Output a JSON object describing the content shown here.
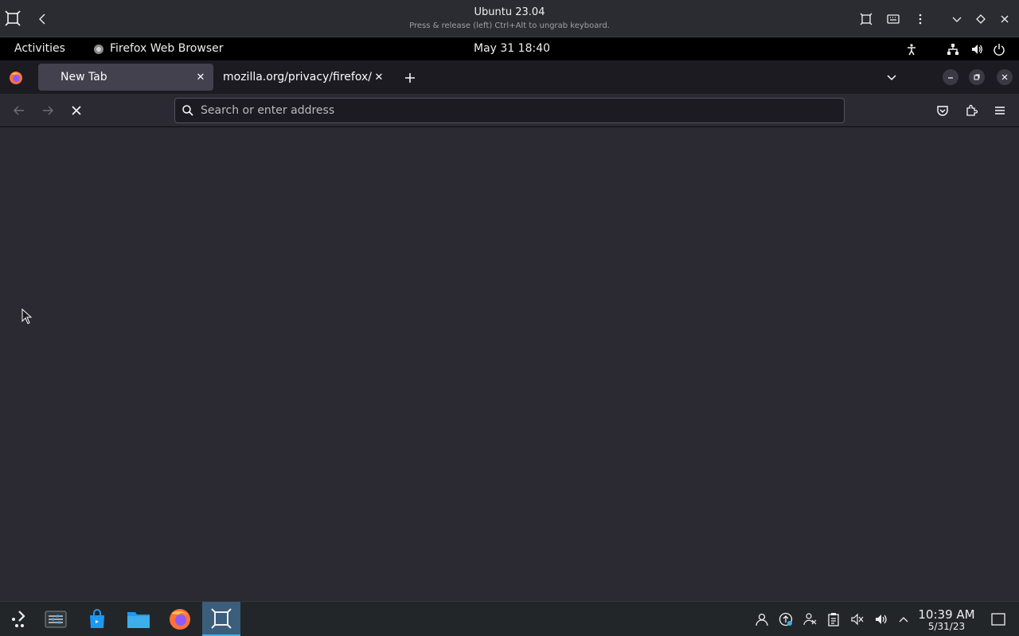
{
  "vm_window": {
    "title": "Ubuntu 23.04",
    "subtitle": "Press & release (left) Ctrl+Alt to ungrab keyboard.",
    "icons": [
      "app-icon",
      "back-icon",
      "fullscreen-icon",
      "keyboard-icon",
      "menu-icon",
      "minimize-icon",
      "maximize-icon",
      "close-icon"
    ]
  },
  "gnome_panel": {
    "activities": "Activities",
    "app_name": "Firefox Web Browser",
    "datetime": "May 31  18:40",
    "icons": [
      "accessibility-icon",
      "network-icon",
      "volume-icon",
      "power-icon"
    ]
  },
  "browser": {
    "tabs": [
      {
        "label": "New Tab",
        "active": true
      },
      {
        "label": "mozilla.org/privacy/firefox/",
        "active": false
      }
    ],
    "urlbar": {
      "placeholder": "Search or enter address",
      "value": ""
    },
    "icons": [
      "firefox-view-icon",
      "new-tab-icon",
      "list-all-tabs-icon",
      "back-icon",
      "forward-icon",
      "stop-icon",
      "search-icon",
      "pocket-icon",
      "extensions-icon",
      "hamburger-menu-icon"
    ]
  },
  "taskbar": {
    "apps": [
      "application-launcher",
      "system-settings",
      "discover",
      "file-manager",
      "firefox",
      "virtual-machine"
    ],
    "clock_time": "10:39 AM",
    "clock_date": "5/31/23",
    "tray_icons": [
      "user-icon",
      "update-icon",
      "kde-connect-icon",
      "clipboard-icon",
      "muted-speaker-icon",
      "speaker-icon",
      "expand-tray-icon",
      "show-desktop-icon"
    ]
  },
  "colors": {
    "browser_chrome": "#1c1b22",
    "browser_toolbar": "#2b2a33",
    "active_tab": "#42414d",
    "taskbar": "#232629",
    "taskbar_accent": "#3daee9"
  }
}
